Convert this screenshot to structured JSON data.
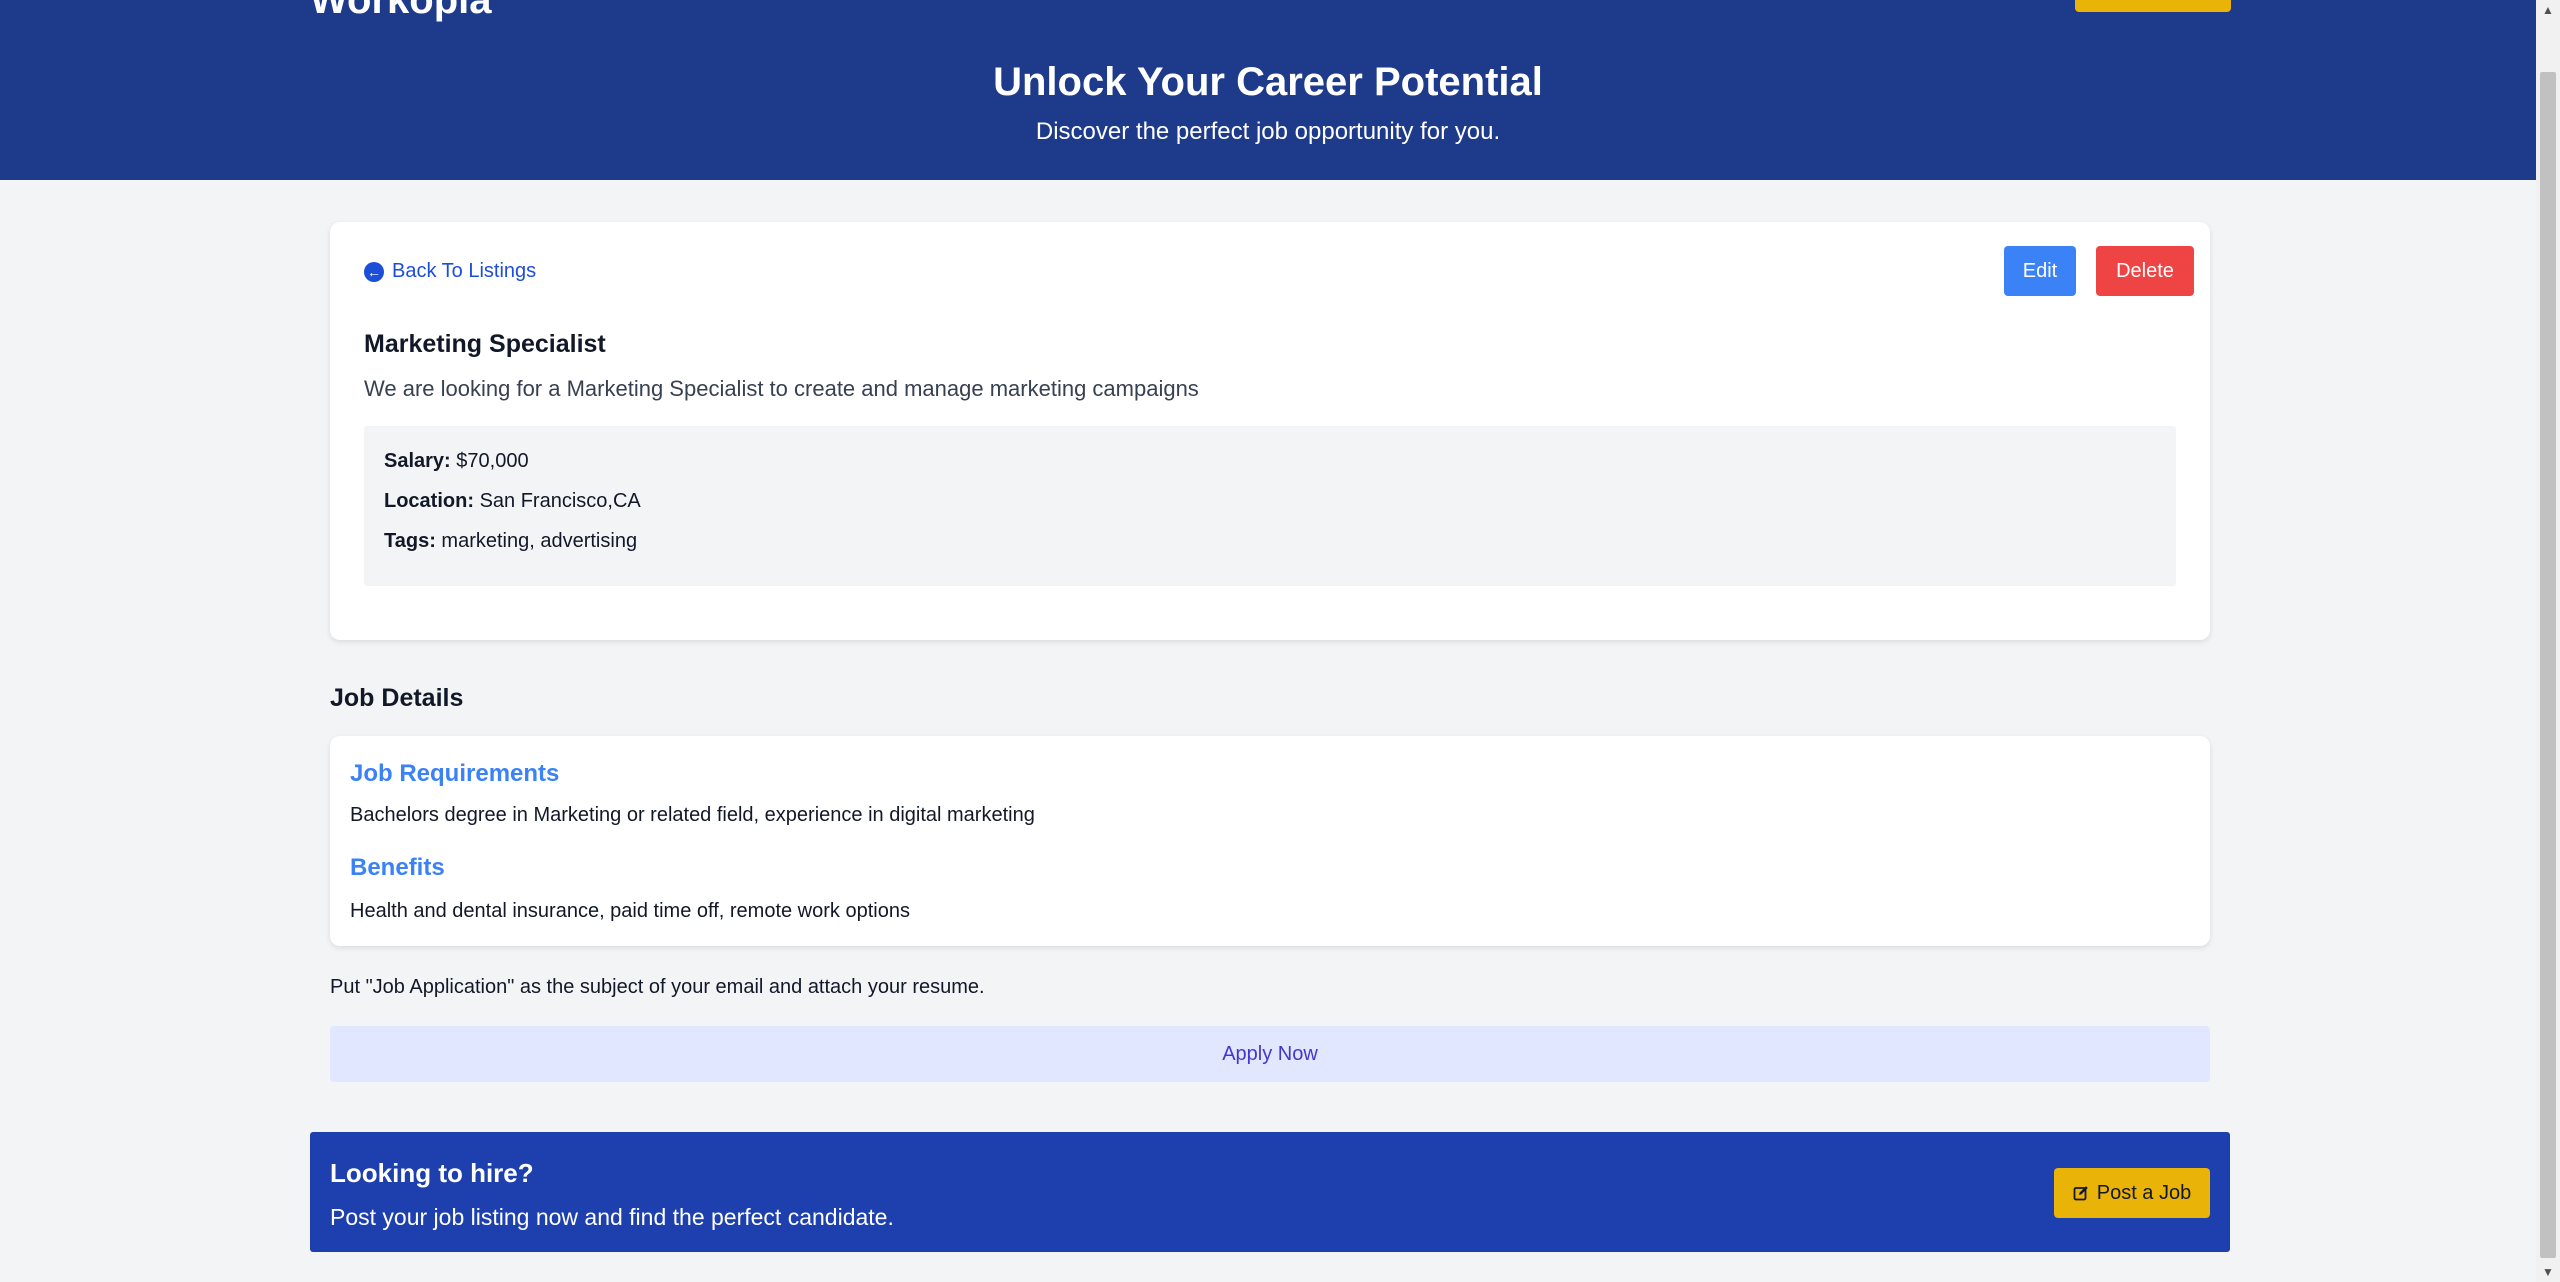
{
  "header": {
    "brand": "Workopia",
    "hero_title": "Unlock Your Career Potential",
    "hero_subtitle": "Discover the perfect job opportunity for you."
  },
  "listing": {
    "back_label": "Back To Listings",
    "edit_label": "Edit",
    "delete_label": "Delete",
    "title": "Marketing Specialist",
    "description": "We are looking for a Marketing Specialist to create and manage marketing campaigns",
    "salary_label": "Salary:",
    "salary": "$70,000",
    "location_label": "Location:",
    "location": "San Francisco,CA",
    "tags_label": "Tags:",
    "tags": "marketing, advertising"
  },
  "details": {
    "section_title": "Job Details",
    "requirements_heading": "Job Requirements",
    "requirements": "Bachelors degree in Marketing or related field, experience in digital marketing",
    "benefits_heading": "Benefits",
    "benefits": "Health and dental insurance, paid time off, remote work options"
  },
  "apply": {
    "note": "Put \"Job Application\" as the subject of your email and attach your resume.",
    "button_label": "Apply Now"
  },
  "hire_banner": {
    "title": "Looking to hire?",
    "subtitle": "Post your job listing now and find the perfect candidate.",
    "button_label": "Post a Job"
  },
  "colors": {
    "header_bg": "#1e3a8a",
    "banner_bg": "#1e40af",
    "accent_blue": "#3b82f6",
    "danger_red": "#ef4444",
    "cta_yellow": "#eab308"
  }
}
